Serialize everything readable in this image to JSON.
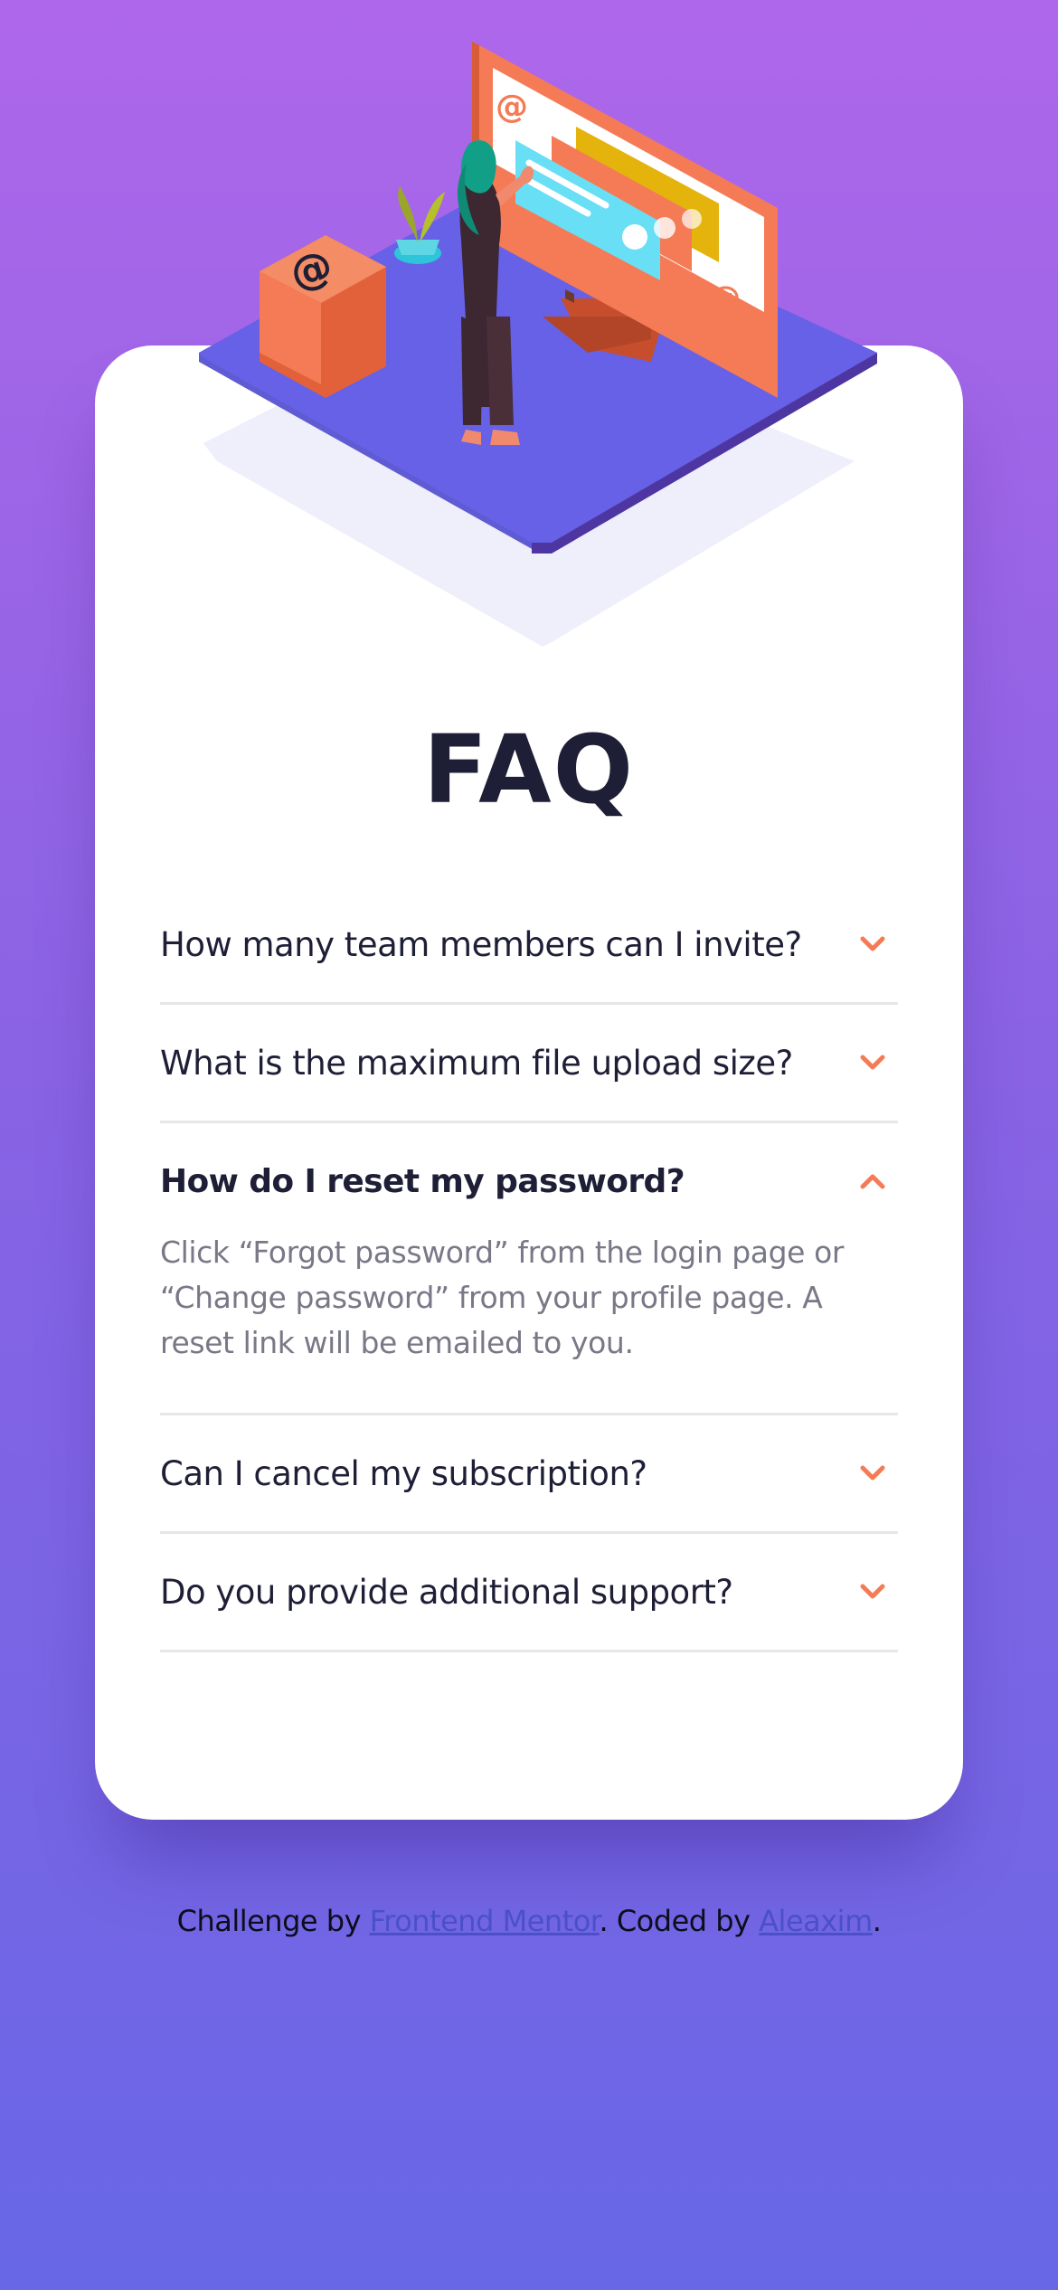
{
  "page": {
    "title": "FAQ"
  },
  "faq": {
    "items": [
      {
        "question": "How many team members can I invite?",
        "open": false,
        "answer": ""
      },
      {
        "question": "What is the maximum file upload size?",
        "open": false,
        "answer": ""
      },
      {
        "question": "How do I reset my password?",
        "open": true,
        "answer": "Click “Forgot password” from the login page or “Change password” from your profile page. A reset link will be emailed to you."
      },
      {
        "question": "Can I cancel my subscription?",
        "open": false,
        "answer": ""
      },
      {
        "question": "Do you provide additional support?",
        "open": false,
        "answer": ""
      }
    ]
  },
  "footer": {
    "prefix": "Challenge by ",
    "link1": "Frontend Mentor",
    "middle": ". Coded by ",
    "link2": "Aleaxim",
    "suffix": "."
  },
  "icons": {
    "chevron_down": "chevron-down-icon",
    "chevron_up": "chevron-up-icon"
  },
  "colors": {
    "accent": "#f47b56",
    "title": "#1e1f36",
    "answer": "#787887",
    "divider": "#e7e7e9",
    "link": "#4b50c9"
  }
}
